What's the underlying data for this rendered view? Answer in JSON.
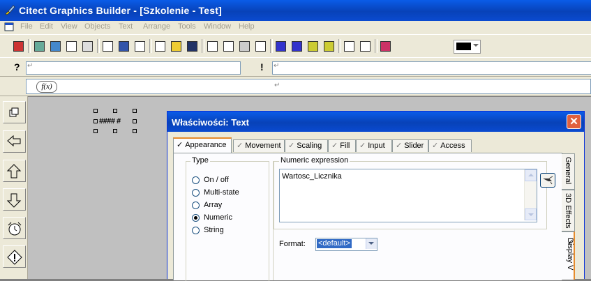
{
  "window": {
    "title": "Citect Graphics Builder - [Szkolenie - Test]"
  },
  "menu": [
    "File",
    "Edit",
    "View",
    "Objects",
    "Text",
    "Arrange",
    "Tools",
    "Window",
    "Help"
  ],
  "prompt_bar": {
    "help_glyph": "?",
    "field1_text": "↵",
    "alert_glyph": "!",
    "field2_text": "↵"
  },
  "function_bar": {
    "fx_label": "f(x)",
    "caret_text": "↵"
  },
  "canvas": {
    "text_object": "#### #"
  },
  "dialog": {
    "title": "Właściwości: Text",
    "close_glyph": "✕",
    "tabs": [
      "Appearance",
      "Movement",
      "Scaling",
      "Fill",
      "Input",
      "Slider",
      "Access"
    ],
    "active_tab": "Appearance",
    "type_group_label": "Type",
    "type_options": [
      "On / off",
      "Multi-state",
      "Array",
      "Numeric",
      "String"
    ],
    "selected_type": "Numeric",
    "expression_label": "Numeric expression",
    "expression_value": "Wartosc_Licznika",
    "format_label": "Format:",
    "format_value": "<default>",
    "side_tabs": [
      "General",
      "3D Effects",
      "Display V"
    ],
    "check_glyph": "✓"
  },
  "colors": {
    "titlebar": "#0842b8",
    "face": "#ece9d8",
    "canvas": "#c0c0c0",
    "active_tab_accent": "#e68b2c",
    "close_button": "#e0603e",
    "selection": "#316ac5"
  }
}
